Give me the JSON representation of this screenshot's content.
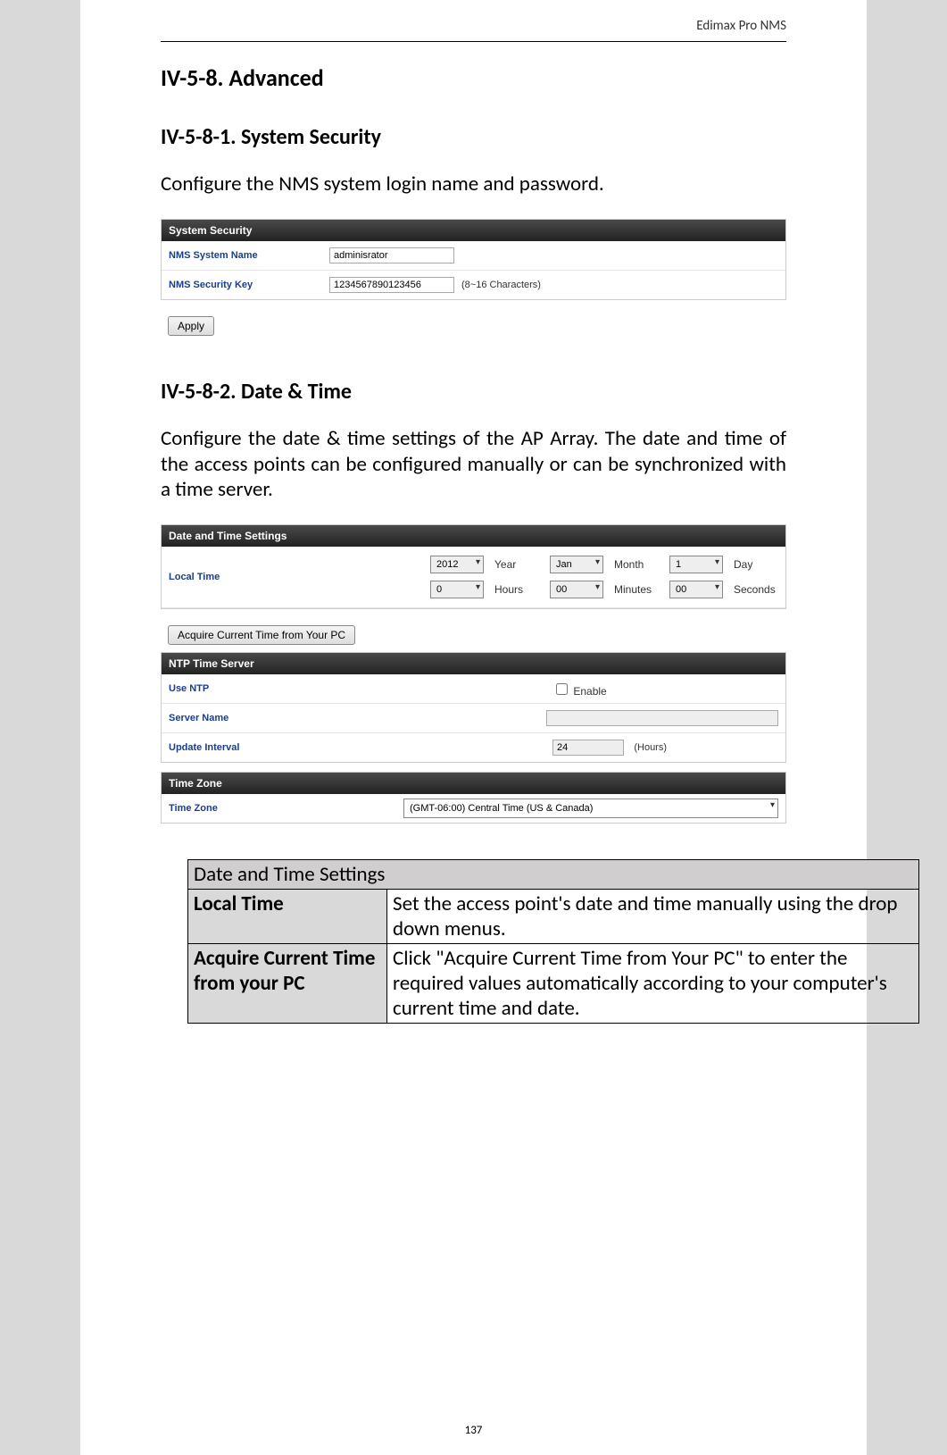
{
  "header": {
    "right": "Edimax Pro NMS"
  },
  "section": {
    "title": "IV-5-8. Advanced"
  },
  "sub1": {
    "title": "IV-5-8-1.    System Security",
    "desc": "Configure the NMS system login name and password."
  },
  "sys_panel": {
    "title": "System Security",
    "rows": {
      "name_label": "NMS System Name",
      "name_value": "adminisrator",
      "key_label": "NMS Security Key",
      "key_value": "1234567890123456",
      "key_hint": "(8~16 Characters)"
    },
    "apply": "Apply"
  },
  "sub2": {
    "title": "IV-5-8-2.    Date & Time",
    "desc": "Configure the date & time settings of the AP Array. The date and time of the access points can be configured manually or can be synchronized with a time server."
  },
  "dt_panel": {
    "title": "Date and Time Settings",
    "local_label": "Local Time",
    "year": "2012",
    "year_lbl": "Year",
    "month": "Jan",
    "month_lbl": "Month",
    "day": "1",
    "day_lbl": "Day",
    "hours": "0",
    "hours_lbl": "Hours",
    "minutes": "00",
    "minutes_lbl": "Minutes",
    "seconds": "00",
    "seconds_lbl": "Seconds",
    "acquire": "Acquire Current Time from Your PC"
  },
  "ntp_panel": {
    "title": "NTP Time Server",
    "use_label": "Use NTP",
    "enable": "Enable",
    "server_label": "Server Name",
    "server_value": "",
    "interval_label": "Update Interval",
    "interval_value": "24",
    "interval_hint": "(Hours)"
  },
  "tz_panel": {
    "title": "Time Zone",
    "label": "Time Zone",
    "value": "(GMT-06:00) Central Time (US & Canada)"
  },
  "desc_table": {
    "title": "Date and Time Settings",
    "r1k": "Local Time",
    "r1v": "Set the access point's date and time manually using the drop down menus.",
    "r2k": "Acquire Current Time from your PC",
    "r2v": "Click \"Acquire Current Time from Your PC\" to enter the required values automatically according to your computer's current time and date."
  },
  "footer": {
    "page": "137"
  }
}
